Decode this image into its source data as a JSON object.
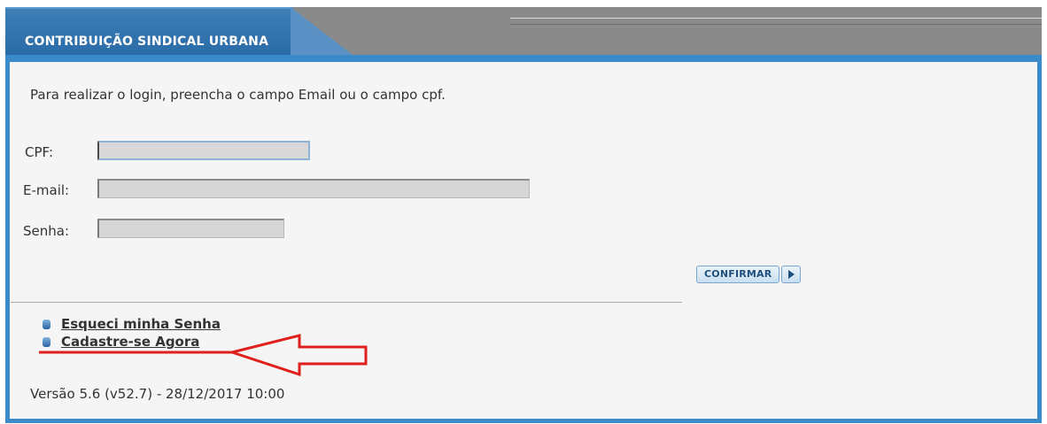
{
  "tab": {
    "title": "CONTRIBUIÇÃO SINDICAL URBANA"
  },
  "form": {
    "instruction": "Para realizar o login, preencha o campo Email ou o campo cpf.",
    "cpf_label": "CPF:",
    "cpf_value": "",
    "email_label": "E-mail:",
    "email_value": "",
    "password_label": "Senha:",
    "password_value": ""
  },
  "confirm_label": "CONFIRMAR",
  "links": {
    "forgot_password": "Esqueci minha Senha",
    "register_now": "Cadastre-se Agora"
  },
  "version": "Versão 5.6 (v52.7) - 28/12/2017 10:00",
  "colors": {
    "accent": "#3a8bc8",
    "annotation": "#e0201c"
  }
}
